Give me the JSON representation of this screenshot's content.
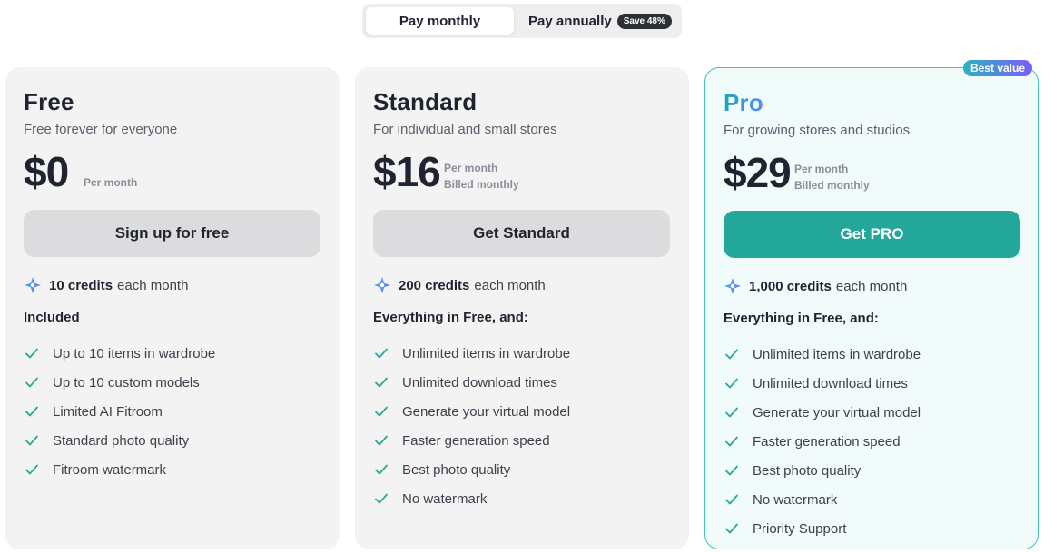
{
  "billing_toggle": {
    "monthly_label": "Pay monthly",
    "annually_label": "Pay annually",
    "save_badge": "Save 48%",
    "selected": "monthly"
  },
  "plans": {
    "free": {
      "name": "Free",
      "description": "Free forever for everyone",
      "price": "$0",
      "price_note_line1": "Per month",
      "price_note_line2": "",
      "cta_label": "Sign up for free",
      "credits_amount": "10 credits",
      "credits_suffix": "each month",
      "included_title": "Included",
      "features": [
        "Up to 10 items in wardrobe",
        "Up to 10 custom models",
        "Limited AI Fitroom",
        "Standard photo quality",
        "Fitroom watermark"
      ]
    },
    "standard": {
      "name": "Standard",
      "description": "For individual and small stores",
      "price": "$16",
      "price_note_line1": "Per month",
      "price_note_line2": "Billed monthly",
      "cta_label": "Get Standard",
      "credits_amount": "200 credits",
      "credits_suffix": "each month",
      "included_title": "Everything in Free, and:",
      "features": [
        "Unlimited items in wardrobe",
        "Unlimited download times",
        "Generate your virtual model",
        "Faster generation speed",
        "Best photo quality",
        "No watermark"
      ]
    },
    "pro": {
      "badge": "Best value",
      "name": "Pro",
      "description": "For growing stores and studios",
      "price": "$29",
      "price_note_line1": "Per month",
      "price_note_line2": "Billed monthly",
      "cta_label": "Get PRO",
      "credits_amount": "1,000 credits",
      "credits_suffix": "each month",
      "included_title": "Everything in Free, and:",
      "features": [
        "Unlimited items in wardrobe",
        "Unlimited download times",
        "Generate your virtual model",
        "Faster generation speed",
        "Best photo quality",
        "No watermark",
        "Priority Support"
      ]
    }
  },
  "colors": {
    "accent_teal": "#24a79b",
    "check_teal": "#2aa897",
    "pro_border": "#43c2b1",
    "card_bg": "#f3f3f4"
  },
  "icons": {
    "credits": "sparkle-icon",
    "feature": "check-icon"
  }
}
